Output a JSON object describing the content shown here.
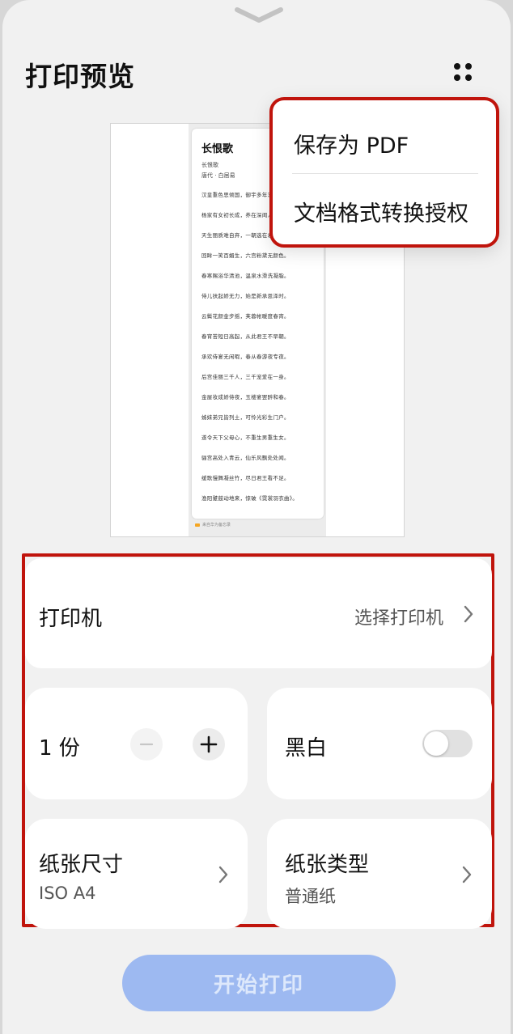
{
  "header": {
    "title": "打印预览"
  },
  "menu": {
    "items": [
      {
        "label": "保存为 PDF"
      },
      {
        "label": "文档格式转换授权"
      }
    ]
  },
  "preview": {
    "title": "长恨歌",
    "subtitle": "长恨歌",
    "author": "唐代 · 白居易",
    "lines": [
      "汉皇重色思倾国，御宇多年求不得。",
      "杨家有女初长成，养在深闺人未识。",
      "天生丽质难自弃，一朝选在君王侧。",
      "回眸一笑百媚生，六宫粉黛无颜色。",
      "春寒赐浴华清池，温泉水滑洗凝脂。",
      "侍儿扶起娇无力，始是新承恩泽时。",
      "云鬓花颜金步摇，芙蓉帐暖度春宵。",
      "春宵苦短日高起，从此君王不早朝。",
      "承欢侍宴无闲暇，春从春游夜专夜。",
      "后宫佳丽三千人，三千宠爱在一身。",
      "金屋妆成娇侍夜，玉楼宴罢醉和春。",
      "姊妹弟兄皆列土，可怜光彩生门户。",
      "遂令天下父母心，不重生男重生女。",
      "骊宫高处入青云，仙乐风飘处处闻。",
      "缓歌慢舞凝丝竹，尽日君王看不足。",
      "渔阳鼙鼓动地来，惊破《霓裳羽衣曲》。"
    ],
    "footer": "来自华为备忘录"
  },
  "printer": {
    "label": "打印机",
    "value": "选择打印机"
  },
  "copies": {
    "label": "1 份",
    "minus": "−",
    "plus": "+"
  },
  "color_mode": {
    "label": "黑白",
    "enabled": false
  },
  "paper_size": {
    "label": "纸张尺寸",
    "value": "ISO A4"
  },
  "paper_type": {
    "label": "纸张类型",
    "value": "普通纸"
  },
  "start_button": {
    "label": "开始打印"
  }
}
